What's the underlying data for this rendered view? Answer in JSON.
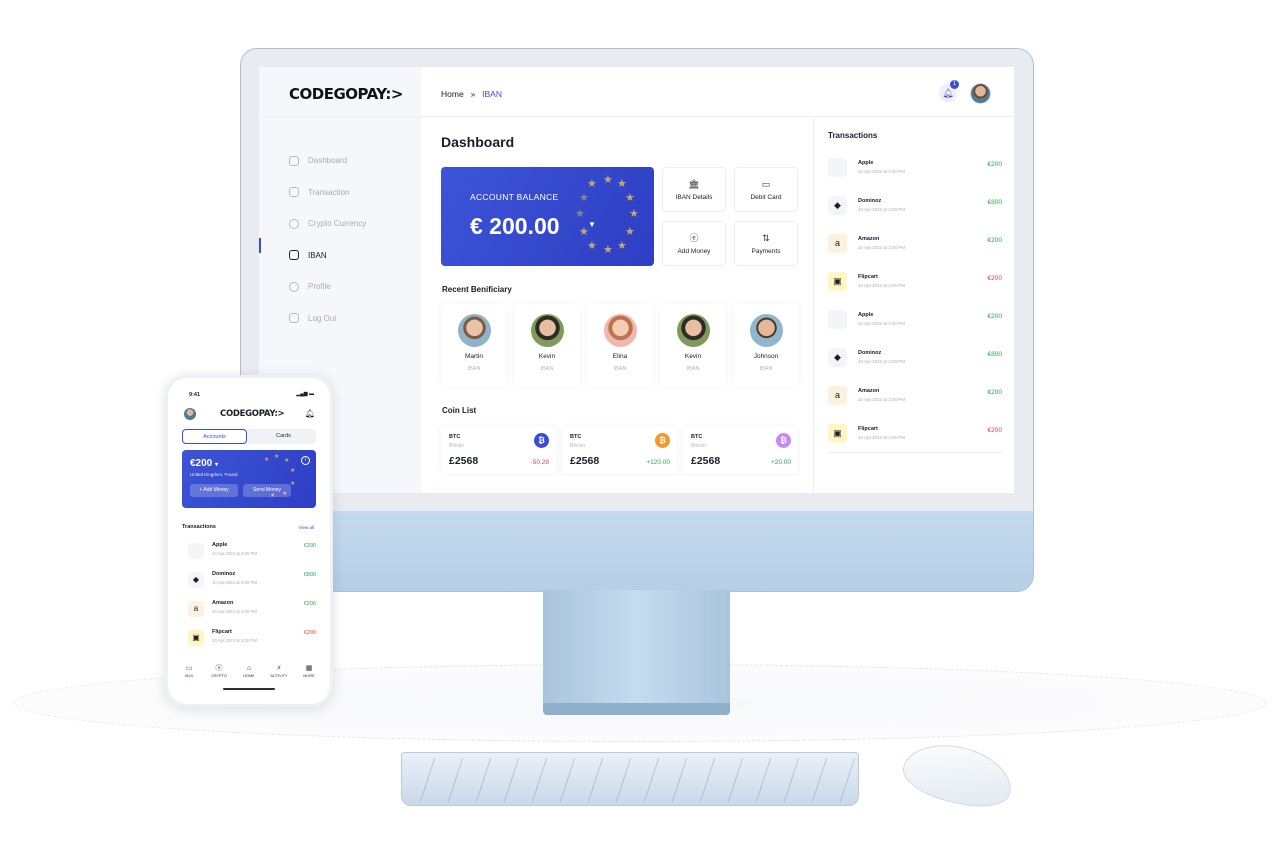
{
  "brand": {
    "logo": "CODEGOPAY:>"
  },
  "breadcrumb": {
    "home": "Home",
    "separator": "»",
    "current": "IBAN"
  },
  "notifications": {
    "count": "1"
  },
  "sidebar": {
    "items": [
      {
        "label": "Dashboard",
        "icon": "grid-icon"
      },
      {
        "label": "Transaction",
        "icon": "wallet-icon"
      },
      {
        "label": "Crypto Currency",
        "icon": "coin-icon"
      },
      {
        "label": "IBAN",
        "icon": "card-icon",
        "active": true
      },
      {
        "label": "Profile",
        "icon": "user-icon"
      },
      {
        "label": "Log Out",
        "icon": "logout-icon"
      }
    ]
  },
  "main": {
    "title": "Dashboard",
    "balance": {
      "label": "ACCOUNT BALANCE",
      "amount": "€ 200.00"
    },
    "actions": [
      {
        "label": "IBAN Details",
        "icon": "bank-icon"
      },
      {
        "label": "Debit Card",
        "icon": "card-icon"
      },
      {
        "label": "Add Money",
        "icon": "euro-circle-icon"
      },
      {
        "label": "Payments",
        "icon": "exchange-icon"
      }
    ],
    "beneficiary_title": "Recent Benificiary",
    "beneficiaries": [
      {
        "name": "Martin",
        "type": "IBAN"
      },
      {
        "name": "Kevin",
        "type": "IBAN"
      },
      {
        "name": "Elina",
        "type": "IBAN"
      },
      {
        "name": "Kevin",
        "type": "IBAN"
      },
      {
        "name": "Johnson",
        "type": "IBAN"
      }
    ],
    "coin_title": "Coin List",
    "coins": [
      {
        "symbol": "BTC",
        "name": "Bitcoin",
        "value": "£2568",
        "change": "-50.28",
        "color": "#3b4cd9"
      },
      {
        "symbol": "BTC",
        "name": "Bitcoin",
        "value": "£2568",
        "change": "+120.00",
        "color": "#f39a2c"
      },
      {
        "symbol": "BTC",
        "name": "Bitcoin",
        "value": "£2568",
        "change": "+20.00",
        "color": "#c58bf0"
      }
    ]
  },
  "transactions": {
    "title": "Transactions",
    "rows": [
      {
        "name": "Apple",
        "date": "10 Apr,2022 at 2:00 PM",
        "amount": "€200",
        "status": "green"
      },
      {
        "name": "Dominoz",
        "date": "10 Apr,2022 at 2:00 PM",
        "amount": "€800",
        "status": "green"
      },
      {
        "name": "Amazon",
        "date": "10 Apr,2022 at 2:00 PM",
        "amount": "€200",
        "status": "green"
      },
      {
        "name": "Flipcart",
        "date": "10 Apr,2022 at 2:00 PM",
        "amount": "€200",
        "status": "red"
      },
      {
        "name": "Apple",
        "date": "10 Apr,2022 at 2:00 PM",
        "amount": "€200",
        "status": "green"
      },
      {
        "name": "Dominoz",
        "date": "10 Apr,2022 at 2:00 PM",
        "amount": "€800",
        "status": "green"
      },
      {
        "name": "Amazon",
        "date": "10 Apr,2022 at 2:00 PM",
        "amount": "€200",
        "status": "green"
      },
      {
        "name": "Flipcart",
        "date": "10 Apr,2022 at 2:00 PM",
        "amount": "€200",
        "status": "red"
      }
    ]
  },
  "phone": {
    "time": "9:41",
    "logo": "CODEGOPAY:>",
    "tabs": [
      "Accounts",
      "Cards"
    ],
    "card": {
      "amount": "€200",
      "caret": "▾",
      "sub": "United Kingdom, Pound",
      "add_money": "+ Add Money",
      "send_money": "Send Money"
    },
    "tx_title": "Transactions",
    "view_all": "View all",
    "rows": [
      {
        "name": "Apple",
        "date": "10 Apr,2022 at 2:00 PM",
        "amount": "€200",
        "status": "green"
      },
      {
        "name": "Dominoz",
        "date": "10 Apr,2022 at 2:00 PM",
        "amount": "€800",
        "status": "green"
      },
      {
        "name": "Amazon",
        "date": "10 Apr,2022 at 2:00 PM",
        "amount": "€200",
        "status": "green"
      },
      {
        "name": "Flipcart",
        "date": "10 Apr,2022 at 2:00 PM",
        "amount": "€200",
        "status": "red"
      }
    ],
    "nav": [
      {
        "label": "IBAN",
        "icon": "card-icon",
        "active": true
      },
      {
        "label": "CRYPTO",
        "icon": "coin-icon"
      },
      {
        "label": "HOME",
        "icon": "home-icon"
      },
      {
        "label": "ACTIVITY",
        "icon": "activity-icon"
      },
      {
        "label": "MORE",
        "icon": "grid-icon"
      }
    ]
  },
  "colors": {
    "accent": "#3b4cd9",
    "positive": "#2ba84a",
    "negative": "#e0443a",
    "imac": "#bcd5ea"
  }
}
